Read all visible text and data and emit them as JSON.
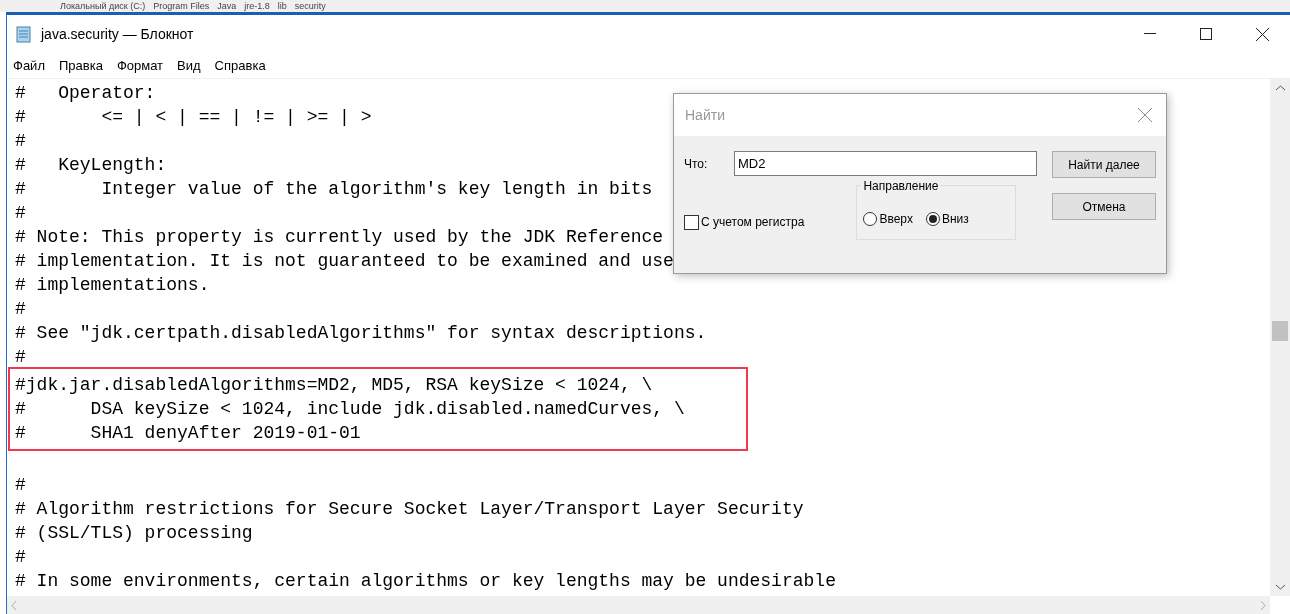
{
  "breadcrumb": [
    "Локальный диск (C:)",
    "Program Files",
    "Java",
    "jre-1.8",
    "lib",
    "security"
  ],
  "window": {
    "title": "java.security — Блокнот"
  },
  "menu": [
    "Файл",
    "Правка",
    "Формат",
    "Вид",
    "Справка"
  ],
  "editor": {
    "lines_before": [
      "#   Operator:",
      "#       <= | < | == | != | >= | >",
      "#",
      "#   KeyLength:",
      "#       Integer value of the algorithm's key length in bits",
      "#",
      "# Note: This property is currently used by the JDK Reference",
      "# implementation. It is not guaranteed to be examined and use",
      "# implementations.",
      "#",
      "# See \"jdk.certpath.disabledAlgorithms\" for syntax descriptions.",
      "#"
    ],
    "highlighted_lines": [
      "#jdk.jar.disabledAlgorithms=MD2, MD5, RSA keySize < 1024, \\",
      "#      DSA keySize < 1024, include jdk.disabled.namedCurves, \\",
      "#      SHA1 denyAfter 2019-01-01"
    ],
    "lines_after": [
      "#",
      "# Algorithm restrictions for Secure Socket Layer/Transport Layer Security",
      "# (SSL/TLS) processing",
      "#",
      "# In some environments, certain algorithms or key lengths may be undesirable"
    ]
  },
  "find_dialog": {
    "title": "Найти",
    "what_label": "Что:",
    "what_value": "MD2",
    "find_next": "Найти далее",
    "cancel": "Отмена",
    "direction_label": "Направление",
    "directions": [
      {
        "label": "Вверх",
        "selected": false
      },
      {
        "label": "Вниз",
        "selected": true
      }
    ],
    "match_case": {
      "label": "С учетом регистра",
      "checked": false
    }
  }
}
